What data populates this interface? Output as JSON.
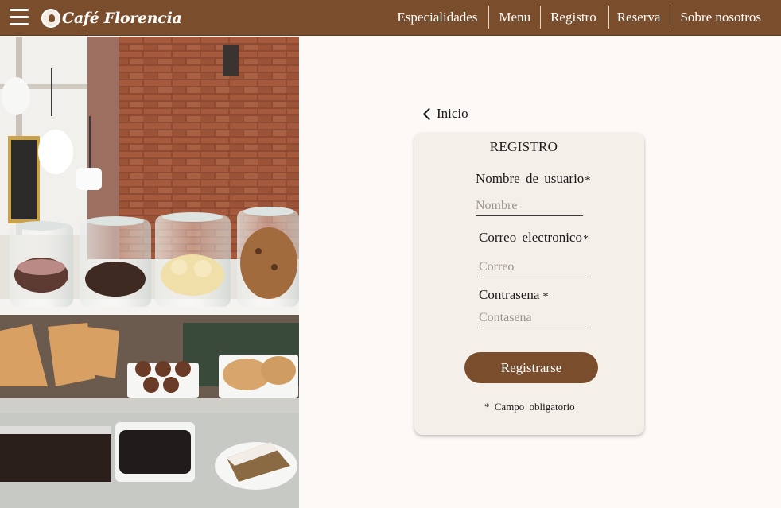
{
  "header": {
    "brand": "Café Florencia",
    "nav": [
      {
        "label": "Especialidades"
      },
      {
        "label": "Menu"
      },
      {
        "label": "Registro"
      },
      {
        "label": "Reserva"
      },
      {
        "label": "Sobre nosotros"
      }
    ]
  },
  "colors": {
    "brand_brown": "#7a4d2c",
    "page_background": "#fdf9f6",
    "card_background": "#f5efea"
  },
  "icons": [
    "hamburger-menu-icon",
    "cafe-logo-icon",
    "chevron-left-icon"
  ],
  "back_link": {
    "label": "Inicio"
  },
  "form": {
    "title": "REGISTRO",
    "fields": [
      {
        "label": "Nombre de usuario",
        "required_mark": "*",
        "placeholder": "Nombre",
        "value": ""
      },
      {
        "label": "Correo electronico",
        "required_mark": "*",
        "placeholder": "Correo",
        "value": ""
      },
      {
        "label": "Contrasena",
        "required_mark": "*",
        "placeholder": "Contasena",
        "value": ""
      }
    ],
    "submit_label": "Registrarse",
    "required_note": "*  Campo obligatorio"
  }
}
